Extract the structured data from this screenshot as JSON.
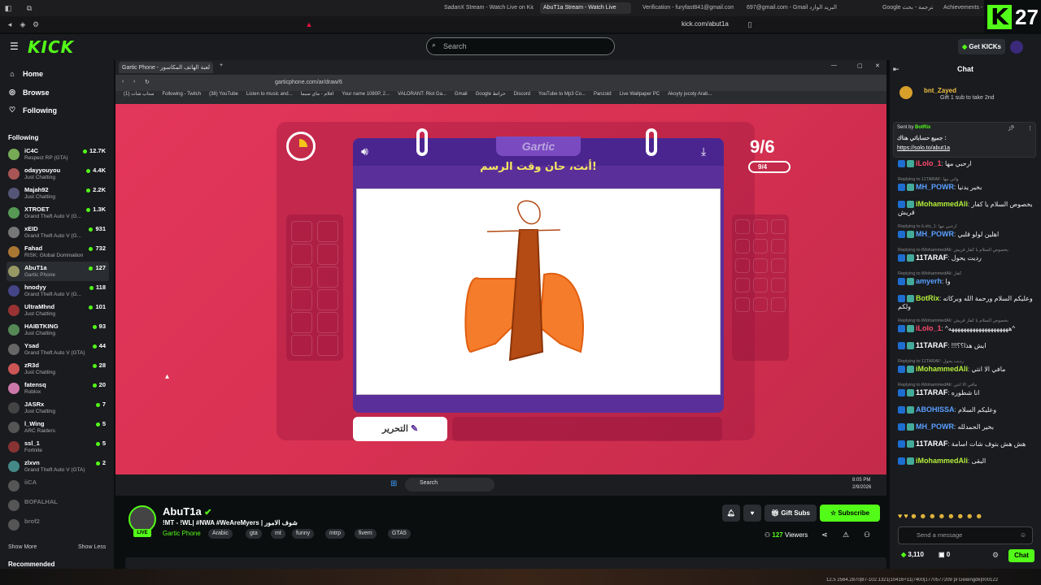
{
  "browser": {
    "tabs": [
      {
        "label": "SadanX Stream - Watch Live on Kick"
      },
      {
        "label": "AbuT1a Stream - Watch Live",
        "active": true
      },
      {
        "label": "Verification - furyfast841@gmail.com"
      },
      {
        "label": "697@gmail.com - Gmail البريد الوارد"
      },
      {
        "label": "Google الترجمة - بحث"
      },
      {
        "label": "Achievements - "
      }
    ],
    "url": "kick.com/abut1a"
  },
  "overlay_counter": "27",
  "kick": {
    "logo": "KICK",
    "search_placeholder": "Search",
    "get_kicks": "Get KICKs"
  },
  "sidebar": {
    "nav": [
      {
        "label": "Home",
        "icon": "home-icon"
      },
      {
        "label": "Browse",
        "icon": "browse-icon"
      },
      {
        "label": "Following",
        "icon": "heart-icon"
      }
    ],
    "following_title": "Following",
    "channels": [
      {
        "name": "iC4C",
        "game": "Respect RP (GTA)",
        "viewers": "12.7K"
      },
      {
        "name": "odayyouyou",
        "game": "Just Chatting",
        "viewers": "4.4K"
      },
      {
        "name": "Majah92",
        "game": "Just Chatting",
        "viewers": "2.2K"
      },
      {
        "name": "XTROET",
        "game": "Grand Theft Auto V (G...",
        "viewers": "1.3K"
      },
      {
        "name": "xEID",
        "game": "Grand Theft Auto V (G...",
        "viewers": "931"
      },
      {
        "name": "Fahad",
        "game": "RISK: Global Domination",
        "viewers": "732"
      },
      {
        "name": "AbuT1a",
        "game": "Gartic Phone",
        "viewers": "127"
      },
      {
        "name": "hnodyy",
        "game": "Grand Theft Auto V (G...",
        "viewers": "118"
      },
      {
        "name": "UltraMhnd",
        "game": "Just Chatting",
        "viewers": "101"
      },
      {
        "name": "HAIBTKING",
        "game": "Just Chatting",
        "viewers": "93"
      },
      {
        "name": "Ysad",
        "game": "Grand Theft Auto V (GTA)",
        "viewers": "44"
      },
      {
        "name": "zR3d",
        "game": "Just Chatting",
        "viewers": "28"
      },
      {
        "name": "fatensq",
        "game": "Roblox",
        "viewers": "20"
      },
      {
        "name": "JASRx",
        "game": "Just Chatting",
        "viewers": "7"
      },
      {
        "name": "l_Wing",
        "game": "ARC Raiders",
        "viewers": "5"
      },
      {
        "name": "ssl_1",
        "game": "Fortnite",
        "viewers": "5"
      },
      {
        "name": "zlxvn",
        "game": "Grand Theft Auto V (GTA)",
        "viewers": "2"
      },
      {
        "name": "iiCA",
        "game": "",
        "viewers": ""
      },
      {
        "name": "BOFALHAL",
        "game": "",
        "viewers": ""
      },
      {
        "name": "brof2",
        "game": "",
        "viewers": ""
      }
    ],
    "show_more": "Show More",
    "show_less": "Show Less",
    "recommended": "Recommended"
  },
  "inner_browser": {
    "tab_title": "Gartic Phone - لعبة الهاتف المكاسور",
    "url": "garticphone.com/ar/draw/6",
    "bookmarks": [
      "سناب شات (1)",
      "Following - Twitch",
      "(38) YouTube",
      "Listen to music and...",
      "افلام - ماي سيما",
      "Your name 1080P, 2...",
      "VALORANT: Riot Ga...",
      "Gmail",
      "Google خرائط",
      "Discord",
      "YouTube to Mp3 Co...",
      "Panzoid",
      "Live Wallpaper PC",
      "Akoyty jocoty Arab..."
    ]
  },
  "game": {
    "logo": "Gartic",
    "title": "أنت، حان وقت الرسم!",
    "score": "9/6",
    "rounds": "9/4",
    "edit_button": "التحرير"
  },
  "taskbar": {
    "search": "Search",
    "time": "8:05 PM",
    "date": "2/9/2026"
  },
  "stream": {
    "streamer": "AbuT1a",
    "live": "LIVE",
    "title": "!MT - !WL| #NWA #WeAreMyers | شوف الامور",
    "category": "Gartic Phone",
    "tags": [
      "Arabic",
      "gta",
      "mt",
      "funny",
      "mtrp",
      "fivem",
      "GTA5"
    ],
    "gift_subs": "Gift Subs",
    "subscribe": "Subscribe",
    "viewers": "127",
    "viewers_label": "Viewers"
  },
  "chat": {
    "title": "Chat",
    "gift_user": "bnt_Zayed",
    "gift_text": "Gift 1 sub to take 2nd",
    "pinned_sender": "Sent by",
    "pinned_user": "BotRix",
    "pinned_text": "جميع حساباتي هناك :",
    "pinned_link": "https://solo.to/abut1a",
    "messages": [
      {
        "user": "iLolo_1",
        "text": "ارحبي مها",
        "reply": "",
        "color": "#ff4b6e"
      },
      {
        "user": "MH_POWR",
        "text": "بخير يدنيا",
        "reply": "Replying to 11TARAF: واتي مها",
        "color": "#5aa0ff"
      },
      {
        "user": "iMohammedAli",
        "text": "بخصوص السلام يا كفار قريش",
        "reply": "",
        "color": "#b6f03a"
      },
      {
        "user": "MH_POWR",
        "text": "اهلين لولو قلبي",
        "reply": "Replying to iLolo_1: ارحبي مها",
        "color": "#5aa0ff"
      },
      {
        "user": "11TARAF",
        "text": "رديت يحول",
        "reply": "Replying to iMohammedAli: بخصوص السلام يا كفار قريش",
        "color": "#ffffff"
      },
      {
        "user": "amyerh",
        "text": "وا",
        "reply": "Replying to iMohammedAli: كفار",
        "color": "#5aa0ff"
      },
      {
        "user": "BotRix",
        "text": "وعليكم السلام ورحمة الله وبركاته ولكم",
        "reply": "",
        "color": "#b6f03a"
      },
      {
        "user": "iLolo_1",
        "text": "^ههههههههههههههههههههه^",
        "reply": "Replying to iMohammedAli: بخصوص السلام يا كفار قريش",
        "color": "#ff4b6e"
      },
      {
        "user": "11TARAF",
        "text": "!!!ايش هذا؟؟",
        "reply": "",
        "color": "#ffffff"
      },
      {
        "user": "iMohammedAli",
        "text": "مافي الا انتي",
        "reply": "Replying to 11TARAF: رديت يحول",
        "color": "#b6f03a"
      },
      {
        "user": "11TARAF",
        "text": "انا شطوره",
        "reply": "Replying to iMohammedAli: مافي الا انتي",
        "color": "#ffffff"
      },
      {
        "user": "ABOHISSA",
        "text": "وعليكم السلام",
        "reply": "",
        "color": "#5aa0ff"
      },
      {
        "user": "MH_POWR",
        "text": "بخير الحمدلله",
        "reply": "",
        "color": "#5aa0ff"
      },
      {
        "user": "11TARAF",
        "text": "هش هش بتوف شات اسامة",
        "reply": "",
        "color": "#ffffff"
      },
      {
        "user": "iMohammedAli",
        "text": "البقى",
        "reply": "",
        "color": "#b6f03a"
      }
    ],
    "send_placeholder": "Send a message",
    "kicks": "3,110",
    "other_count": "0",
    "chat_button": "Chat"
  },
  "status_strip": "12.5 2564.2870|87-102.1321|10416+11|7400|1770577209 pl Gewingdk|000122"
}
